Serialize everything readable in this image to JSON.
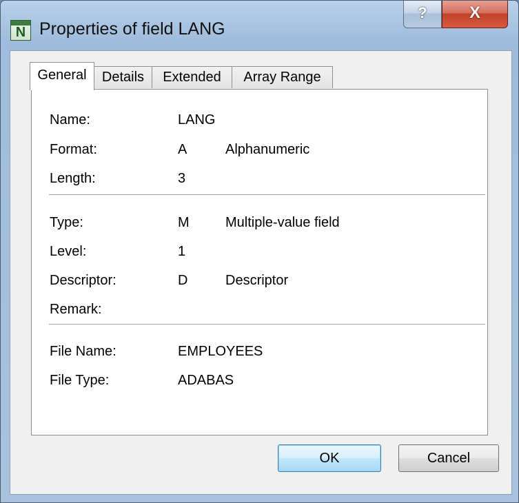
{
  "window": {
    "title": "Properties of field LANG",
    "icon_letter": "N",
    "help_label": "?",
    "close_label": "X"
  },
  "tabs": [
    {
      "label": "General",
      "active": true
    },
    {
      "label": "Details",
      "active": false
    },
    {
      "label": "Extended",
      "active": false
    },
    {
      "label": "Array Range",
      "active": false
    }
  ],
  "fields": {
    "name": {
      "label": "Name:",
      "value": "LANG"
    },
    "format": {
      "label": "Format:",
      "value": "A",
      "desc": "Alphanumeric"
    },
    "length": {
      "label": "Length:",
      "value": "3"
    },
    "type": {
      "label": "Type:",
      "value": "M",
      "desc": "Multiple-value field"
    },
    "level": {
      "label": "Level:",
      "value": "1"
    },
    "descriptor": {
      "label": "Descriptor:",
      "value": "D",
      "desc": "Descriptor"
    },
    "remark": {
      "label": "Remark:",
      "value": ""
    },
    "file_name": {
      "label": "File Name:",
      "value": "EMPLOYEES"
    },
    "file_type": {
      "label": "File Type:",
      "value": "ADABAS"
    }
  },
  "buttons": {
    "ok": "OK",
    "cancel": "Cancel"
  }
}
